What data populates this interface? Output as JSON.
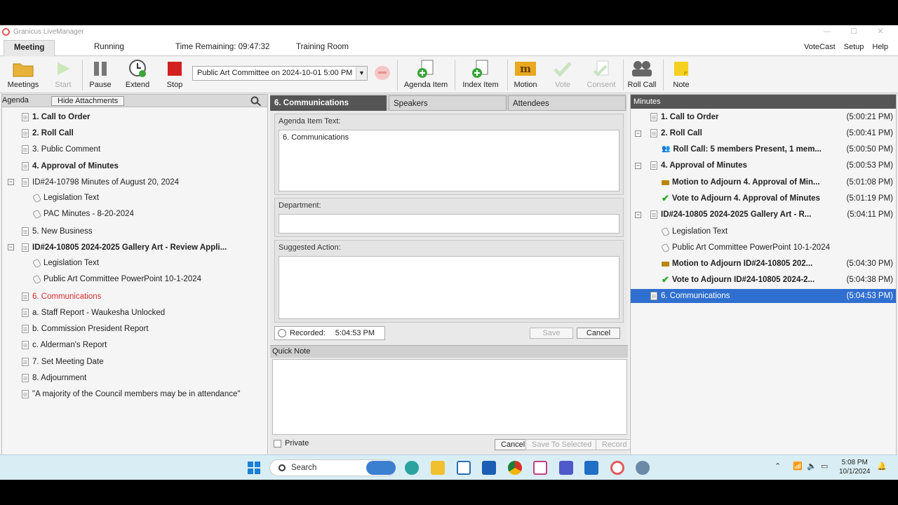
{
  "window": {
    "title": "Granicus LiveManager",
    "controls": [
      "—",
      "☐",
      "✕"
    ]
  },
  "menubar": {
    "meeting_tab": "Meeting",
    "status": "Running",
    "time_remaining": "Time Remaining: 09:47:32",
    "room": "Training Room",
    "right": [
      "VoteCast",
      "Setup",
      "Help"
    ]
  },
  "toolbar": {
    "meetings": "Meetings",
    "start": "Start",
    "pause": "Pause",
    "extend": "Extend",
    "stop": "Stop",
    "meeting_select": "Public Art Committee on 2024-10-01 5:00 PM",
    "agenda_item": "Agenda Item",
    "index_item": "Index Item",
    "motion": "Motion",
    "motion_logo": "m",
    "vote": "Vote",
    "consent": "Consent",
    "roll_call": "Roll Call",
    "note": "Note"
  },
  "agenda": {
    "title": "Agenda",
    "hide_attachments": "Hide Attachments",
    "items": [
      {
        "text": "1. Call to Order",
        "style": "bold"
      },
      {
        "text": "2. Roll Call",
        "style": "bold"
      },
      {
        "text": "3. Public Comment",
        "style": "normal"
      },
      {
        "text": "4. Approval of Minutes",
        "style": "bold"
      },
      {
        "text": "ID#24-10798 Minutes of August 20, 2024",
        "style": "normal"
      },
      {
        "text": "Legislation Text",
        "style": "attachment"
      },
      {
        "text": "PAC Minutes - 8-20-2024",
        "style": "attachment"
      },
      {
        "text": "5. New Business",
        "style": "normal"
      },
      {
        "text": "ID#24-10805 2024-2025 Gallery Art - Review Appli...",
        "style": "bold"
      },
      {
        "text": "Legislation Text",
        "style": "attachment"
      },
      {
        "text": "Public Art Committee PowerPoint 10-1-2024",
        "style": "attachment"
      },
      {
        "text": "6. Communications",
        "style": "red"
      },
      {
        "text": "a. Staff Report - Waukesha Unlocked",
        "style": "normal"
      },
      {
        "text": "b. Commission President Report",
        "style": "normal"
      },
      {
        "text": "c. Alderman's Report",
        "style": "normal"
      },
      {
        "text": "7. Set Meeting Date",
        "style": "normal"
      },
      {
        "text": "8. Adjournment",
        "style": "normal"
      },
      {
        "text": "\"A majority of the Council members may be in attendance\"",
        "style": "normal"
      }
    ]
  },
  "center": {
    "tabs": [
      "6. Communications",
      "Speakers",
      "Attendees"
    ],
    "agenda_item_label": "Agenda Item Text:",
    "agenda_item_value": "6. Communications",
    "department_label": "Department:",
    "department_value": "",
    "suggested_label": "Suggested Action:",
    "suggested_value": "",
    "recorded_label": "Recorded:",
    "recorded_value": "5:04:53 PM",
    "save": "Save",
    "cancel": "Cancel",
    "quick_note": "Quick Note",
    "private": "Private",
    "qn_cancel": "Cancel",
    "save_to_selected": "Save To Selected",
    "record": "Record"
  },
  "minutes": {
    "title": "Minutes",
    "items": [
      {
        "text": "1. Call to Order",
        "time": "(5:00:21 PM)",
        "icon": "doc"
      },
      {
        "text": "2. Roll Call",
        "time": "(5:00:41 PM)",
        "icon": "doc"
      },
      {
        "text": "Roll Call: 5 members Present, 1 mem...",
        "time": "(5:00:50 PM)",
        "icon": "people"
      },
      {
        "text": "4. Approval of Minutes",
        "time": "(5:00:53 PM)",
        "icon": "doc"
      },
      {
        "text": "Motion to Adjourn 4. Approval of Min...",
        "time": "(5:01:08 PM)",
        "icon": "motion"
      },
      {
        "text": "Vote to Adjourn 4. Approval of Minutes",
        "time": "(5:01:19 PM)",
        "icon": "check"
      },
      {
        "text": "ID#24-10805 2024-2025 Gallery Art - R...",
        "time": "(5:04:11 PM)",
        "icon": "doc"
      },
      {
        "text": "Legislation Text",
        "time": "",
        "icon": "attachment"
      },
      {
        "text": "Public Art Committee PowerPoint 10-1-2024",
        "time": "",
        "icon": "attachment"
      },
      {
        "text": "Motion to Adjourn ID#24-10805 202...",
        "time": "(5:04:30 PM)",
        "icon": "motion"
      },
      {
        "text": "Vote to Adjourn ID#24-10805 2024-2...",
        "time": "(5:04:38 PM)",
        "icon": "check"
      },
      {
        "text": "6. Communications",
        "time": "(5:04:53 PM)",
        "icon": "doc"
      }
    ]
  },
  "taskbar": {
    "search": "Search",
    "time": "5:08 PM",
    "date": "10/1/2024"
  },
  "colors": {
    "accent": "#2f6fcf",
    "current_item": "#d83030",
    "tab_active": "#555555"
  }
}
